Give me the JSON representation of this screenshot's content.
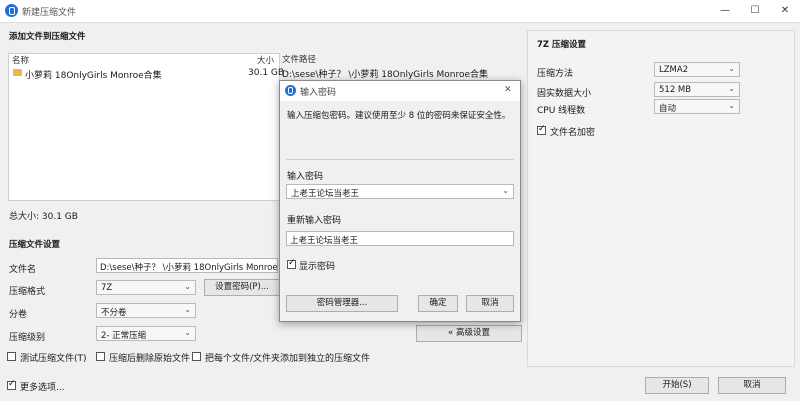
{
  "window": {
    "title": "新建压缩文件",
    "min": "—",
    "max": "☐",
    "close": "✕"
  },
  "files": {
    "section_title": "添加文件到压缩文件",
    "col_name": "名称",
    "col_size": "大小",
    "col_path": "文件路径",
    "rows": [
      {
        "name": "小萝莉 18OnlyGirls Monroe合集",
        "size": "30.1 GB",
        "path": "D:\\sese\\种子？ \\小萝莉 18OnlyGirls Monroe合集"
      }
    ],
    "total": "总大小: 30.1 GB"
  },
  "settings": {
    "section_title": "压缩文件设置",
    "filename_label": "文件名",
    "filename_value": "D:\\sese\\种子？ \\小萝莉 18OnlyGirls Monroe合集",
    "format_label": "压缩格式",
    "format_value": "7Z",
    "set_password": "设置密码(P)...",
    "split_label": "分卷",
    "split_value": "不分卷",
    "level_label": "压缩级别",
    "level_value": "2- 正常压缩",
    "advanced": "« 高级设置",
    "test_archive": "测试压缩文件(T)",
    "delete_after": "压缩后删除原始文件",
    "separate": "把每个文件/文件夹添加到独立的压缩文件"
  },
  "right": {
    "section_title": "7Z 压缩设置",
    "method_label": "压缩方法",
    "method_value": "LZMA2",
    "block_label": "固实数据大小",
    "block_value": "512 MB",
    "threads_label": "CPU 线程数",
    "threads_value": "自动",
    "encrypt_names": "文件名加密"
  },
  "footer": {
    "more_options": "更多选项...",
    "start": "开始(S)",
    "cancel": "取消"
  },
  "dialog": {
    "title": "输入密码",
    "close": "✕",
    "hint": "输入压缩包密码。建议使用至少 8 位的密码来保证安全性。",
    "password_label": "输入密码",
    "password_value": "上老王论坛当老王",
    "reenter_label": "重新输入密码",
    "reenter_value": "上老王论坛当老王",
    "show_password": "显示密码",
    "manager": "密码管理器...",
    "ok": "确定",
    "cancel": "取消"
  }
}
